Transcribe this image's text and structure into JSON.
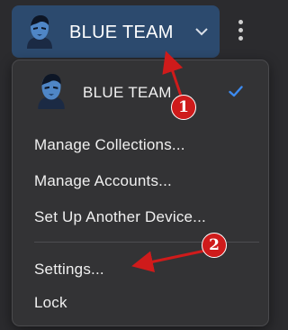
{
  "header": {
    "team_name": "BLUE TEAM",
    "avatar_icon": "team-avatar-icon",
    "chevron_icon": "chevron-down-icon",
    "more_icon": "kebab-menu-icon"
  },
  "menu": {
    "selected_team": "BLUE TEAM",
    "check_icon": "checkmark-icon",
    "items": [
      {
        "label": "Manage Collections..."
      },
      {
        "label": "Manage Accounts..."
      },
      {
        "label": "Set Up Another Device..."
      },
      {
        "label": "Settings..."
      },
      {
        "label": "Lock"
      }
    ]
  },
  "annotations": [
    {
      "number": "1"
    },
    {
      "number": "2"
    }
  ],
  "colors": {
    "accent": "#2c4a6e",
    "check": "#3d8bf0",
    "marker": "#cf1b1b"
  }
}
